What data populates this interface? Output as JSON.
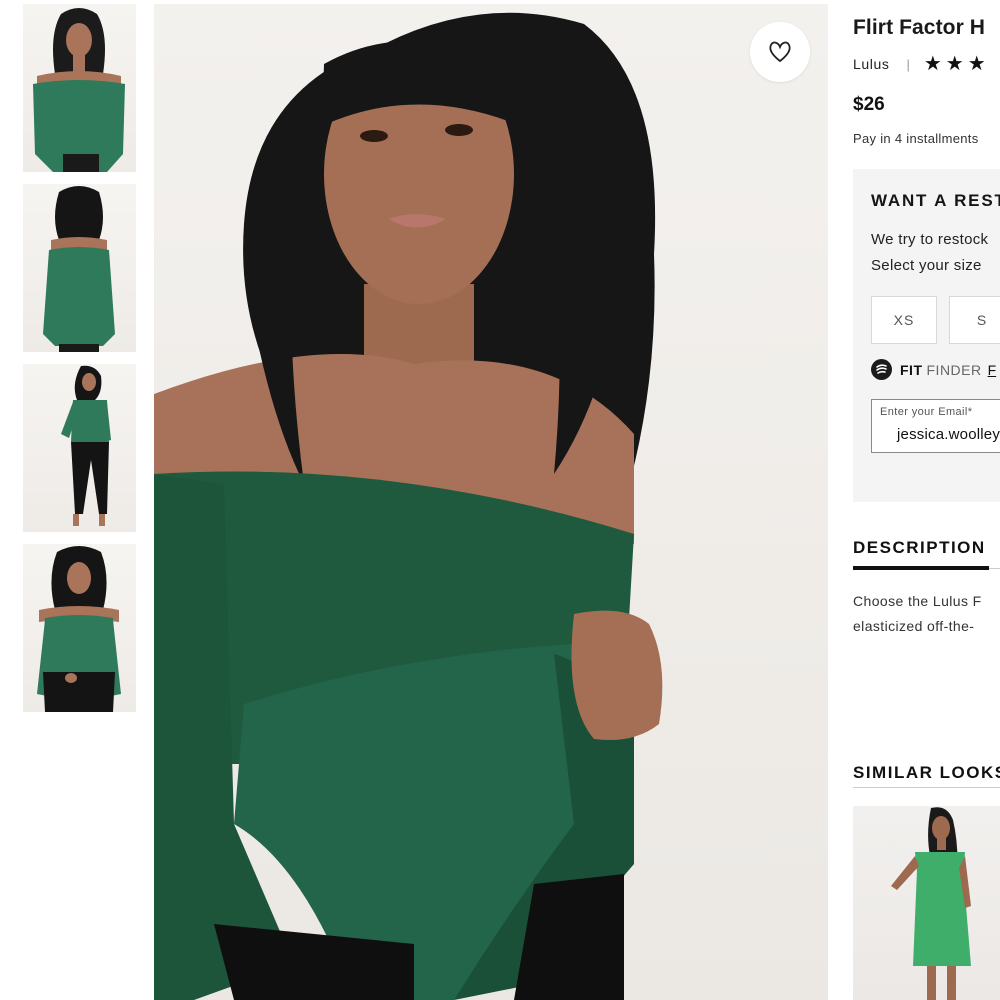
{
  "product": {
    "title": "Flirt Factor H",
    "brand": "Lulus",
    "separator": "|",
    "stars": "★★★",
    "price": "$26",
    "installments": "Pay in 4 installments"
  },
  "restock": {
    "title": "WANT A REST",
    "text_line1": "We try to restock",
    "text_line2": "Select your size",
    "sizes": [
      "XS",
      "S"
    ]
  },
  "fit_finder": {
    "bold": "FIT",
    "light": "FINDER",
    "link": "F"
  },
  "email": {
    "label": "Enter your Email*",
    "value": "jessica.woolley"
  },
  "description": {
    "tab": "DESCRIPTION",
    "line1": "Choose the Lulus F",
    "line2": "elasticized off-the-"
  },
  "similar": {
    "title": "SIMILAR LOOKS"
  },
  "colors": {
    "product_green": "#1f5a3e",
    "similar_green": "#3fae6a",
    "panel_bg": "#f4f4f4",
    "text": "#111111"
  },
  "icons": {
    "favorite": "heart-outline-icon",
    "fit_finder": "fit-finder-logo-icon"
  }
}
